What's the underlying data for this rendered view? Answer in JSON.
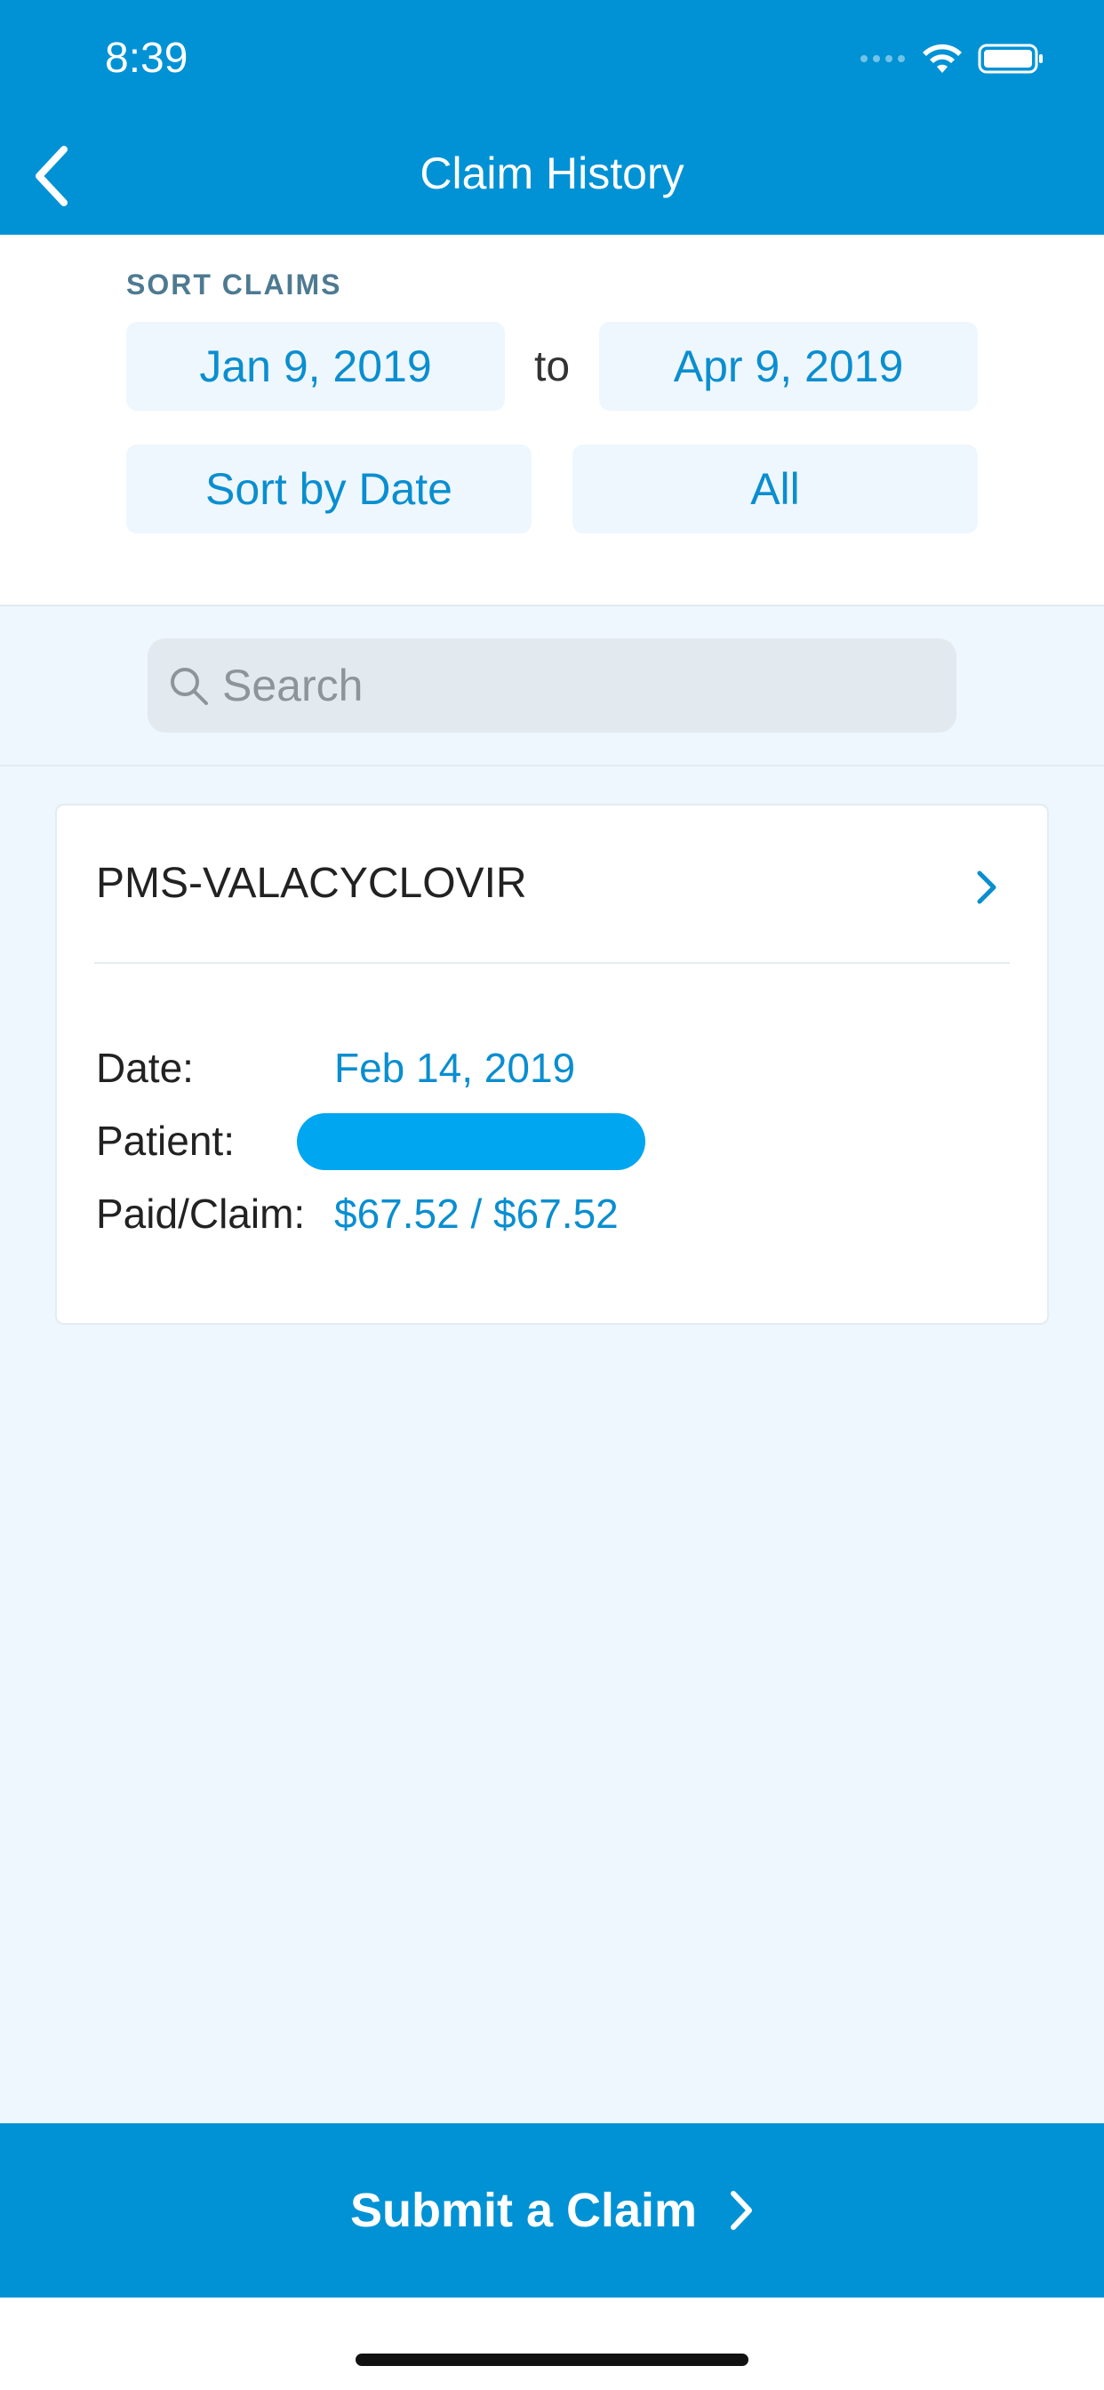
{
  "status_bar": {
    "time": "8:39"
  },
  "nav": {
    "title": "Claim History"
  },
  "sort": {
    "label": "SORT CLAIMS",
    "start_date": "Jan 9, 2019",
    "to_label": "to",
    "end_date": "Apr 9, 2019",
    "sort_by": "Sort by Date",
    "filter": "All"
  },
  "search": {
    "placeholder": "Search"
  },
  "claims": [
    {
      "name": "PMS-VALACYCLOVIR",
      "date_label": "Date:",
      "date": "Feb 14, 2019",
      "patient_label": "Patient:",
      "paid_label": "Paid/Claim:",
      "paid_claim": "$67.52 / $67.52"
    }
  ],
  "footer": {
    "submit_label": "Submit a Claim"
  },
  "colors": {
    "brand": "#0092d5",
    "accent_text": "#0a8ed0",
    "background": "#eef7fd"
  }
}
